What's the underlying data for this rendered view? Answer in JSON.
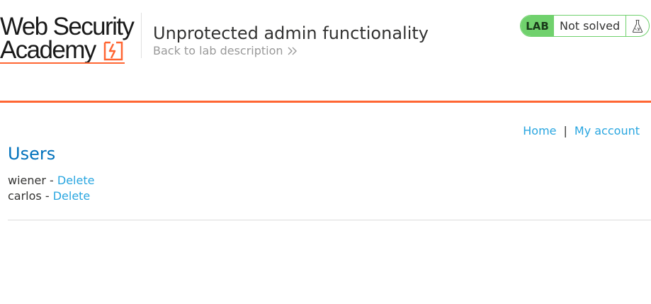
{
  "brand": {
    "line1": "Web Security",
    "line2": "Academy",
    "accent_color": "#ff6633"
  },
  "lab": {
    "title": "Unprotected admin functionality",
    "back_link": "Back to lab description",
    "status_label": "LAB",
    "status_text": "Not solved",
    "status_color": "#70d16d",
    "status_icon": "flask-icon"
  },
  "nav": {
    "home": "Home",
    "separator": "|",
    "my_account": "My account"
  },
  "users": {
    "heading": "Users",
    "items": [
      {
        "name": "wiener",
        "sep": " - ",
        "action": "Delete"
      },
      {
        "name": "carlos",
        "sep": " - ",
        "action": "Delete"
      }
    ]
  },
  "colors": {
    "link": "#29a6e0",
    "heading": "#0071bc",
    "text": "#333332",
    "muted": "#999999"
  }
}
